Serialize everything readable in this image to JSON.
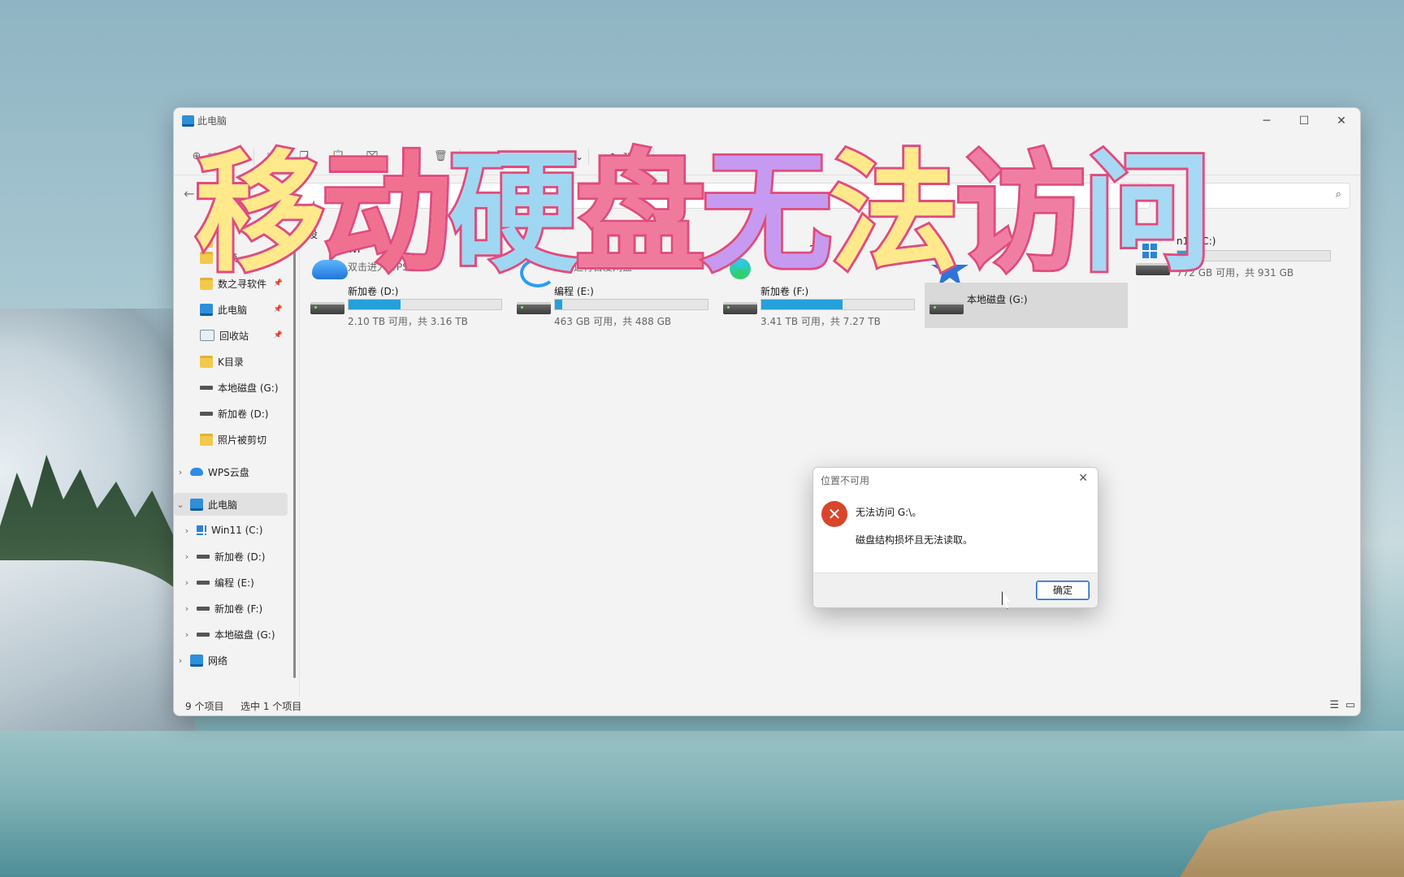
{
  "window": {
    "title": "此电脑"
  },
  "toolbar": {
    "new_label": "新建",
    "sort_label": "排序",
    "view_label": "查看",
    "eject_label": "弹出",
    "more_label": "···"
  },
  "main": {
    "section_label": "设"
  },
  "sidebar": {
    "items": [
      {
        "label": "视频",
        "icon": "folder-icon",
        "pinned": true
      },
      {
        "label": "数之寻软件",
        "icon": "folder-icon",
        "pinned": true
      },
      {
        "label": "此电脑",
        "icon": "pc-icon",
        "pinned": true
      },
      {
        "label": "回收站",
        "icon": "recycle-bin-icon",
        "pinned": true
      },
      {
        "label": "K目录",
        "icon": "folder-icon",
        "pinned": false
      },
      {
        "label": "本地磁盘 (G:)",
        "icon": "drive-icon",
        "pinned": false
      },
      {
        "label": "新加卷 (D:)",
        "icon": "drive-icon",
        "pinned": false
      },
      {
        "label": "照片被剪切",
        "icon": "folder-icon",
        "pinned": false
      }
    ],
    "wps_cloud": "WPS云盘",
    "this_pc": "此电脑",
    "drives": [
      {
        "label": "Win11 (C:)"
      },
      {
        "label": "新加卷 (D:)"
      },
      {
        "label": "编程 (E:)"
      },
      {
        "label": "新加卷 (F:)"
      },
      {
        "label": "本地磁盘 (G:)"
      }
    ],
    "network": "网络"
  },
  "tiles": {
    "wps": {
      "name": "WP",
      "sub": "双击进入WPS云盘"
    },
    "baidu": {
      "sub": "双击运行百度网盘"
    },
    "tencent": {
      "name": "2"
    },
    "c": {
      "name": "n11 (C:)",
      "sub": "772 GB 可用，共 931 GB",
      "used_fraction": 0.17
    },
    "d": {
      "name": "新加卷 (D:)",
      "sub": "2.10 TB 可用，共 3.16 TB",
      "used_fraction": 0.34
    },
    "e": {
      "name": "编程 (E:)",
      "sub": "463 GB 可用，共 488 GB",
      "used_fraction": 0.05
    },
    "f": {
      "name": "新加卷 (F:)",
      "sub": "3.41 TB 可用，共 7.27 TB",
      "used_fraction": 0.53
    },
    "g": {
      "name": "本地磁盘 (G:)"
    }
  },
  "status": {
    "count": "9 个项目",
    "selected": "选中 1 个项目"
  },
  "overlay": {
    "chars": [
      "移",
      "动",
      "硬",
      "盘",
      "无",
      "法",
      "访",
      "问"
    ],
    "colors": [
      "#ffe98a",
      "#f0708f",
      "#9fd7f2",
      "#ef7a9c",
      "#c69af0",
      "#ffe98a",
      "#f07ea3",
      "#a6d9f4"
    ]
  },
  "dialog": {
    "title": "位置不可用",
    "message": "无法访问 G:\\。",
    "detail": "磁盘结构损坏且无法读取。",
    "ok_label": "确定"
  }
}
